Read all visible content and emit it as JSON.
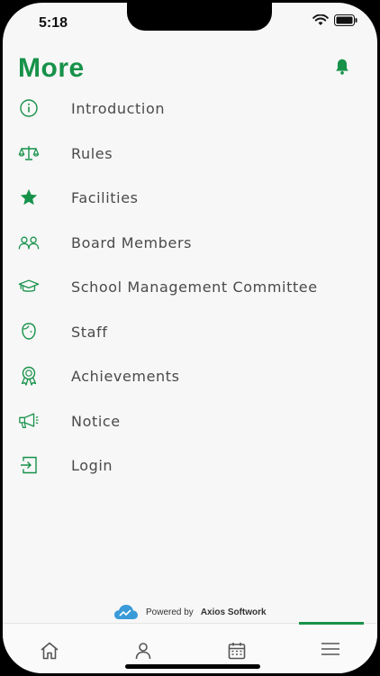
{
  "status_bar": {
    "time": "5:18"
  },
  "header": {
    "title": "More",
    "bell_icon": "bell-icon"
  },
  "menu": {
    "items": [
      {
        "label": "Introduction",
        "icon": "info-icon"
      },
      {
        "label": "Rules",
        "icon": "scales-icon"
      },
      {
        "label": "Facilities",
        "icon": "star-icon"
      },
      {
        "label": "Board Members",
        "icon": "people-icon"
      },
      {
        "label": "School Management Committee",
        "icon": "graduation-cap-icon"
      },
      {
        "label": "Staff",
        "icon": "face-icon"
      },
      {
        "label": "Achievements",
        "icon": "award-icon"
      },
      {
        "label": "Notice",
        "icon": "megaphone-icon"
      },
      {
        "label": "Login",
        "icon": "login-icon"
      }
    ]
  },
  "footer": {
    "powered_by": "Powered by",
    "company": "Axios Softwork"
  },
  "tabbar": {
    "tabs": [
      {
        "icon": "home-icon"
      },
      {
        "icon": "user-icon"
      },
      {
        "icon": "calendar-icon"
      },
      {
        "icon": "menu-icon"
      }
    ],
    "active_index": 3
  },
  "colors": {
    "accent": "#17924a",
    "text": "#4a4a4a",
    "background": "#f7f7f7"
  }
}
